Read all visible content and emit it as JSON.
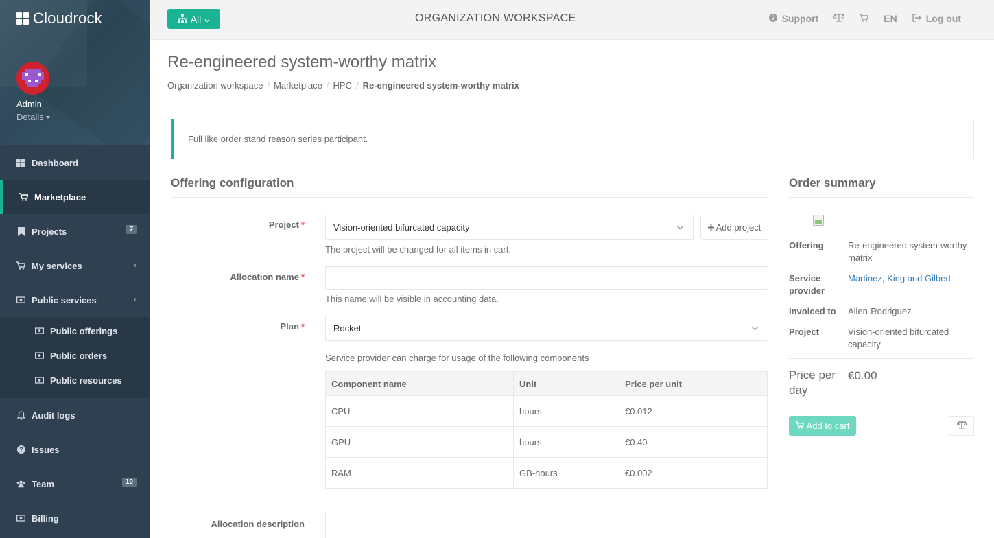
{
  "brand": {
    "name": "Cloudrock"
  },
  "user": {
    "name": "Admin",
    "details_label": "Details"
  },
  "nav": {
    "dashboard": "Dashboard",
    "marketplace": "Marketplace",
    "projects": "Projects",
    "projects_badge": "7",
    "my_services": "My services",
    "public_services": "Public services",
    "public_offerings": "Public offerings",
    "public_orders": "Public orders",
    "public_resources": "Public resources",
    "audit_logs": "Audit logs",
    "issues": "Issues",
    "team": "Team",
    "team_badge": "10",
    "billing": "Billing"
  },
  "topbar": {
    "filter_label": "All",
    "workspace_title": "ORGANIZATION WORKSPACE",
    "support": "Support",
    "language": "EN",
    "logout": "Log out"
  },
  "page": {
    "title": "Re-engineered system-worthy matrix",
    "breadcrumbs": [
      "Organization workspace",
      "Marketplace",
      "HPC"
    ],
    "breadcrumb_current": "Re-engineered system-worthy matrix",
    "alert": "Full like order stand reason series participant."
  },
  "config": {
    "section_title": "Offering configuration",
    "project_label": "Project",
    "project_value": "Vision-oriented bifurcated capacity",
    "add_project": "Add project",
    "project_help": "The project will be changed for all items in cart.",
    "allocation_label": "Allocation name",
    "allocation_value": "",
    "allocation_help": "This name will be visible in accounting data.",
    "plan_label": "Plan",
    "plan_value": "Rocket",
    "components_intro": "Service provider can charge for usage of the following components",
    "table_headers": [
      "Component name",
      "Unit",
      "Price per unit"
    ],
    "components": [
      {
        "name": "CPU",
        "unit": "hours",
        "price": "€0.012"
      },
      {
        "name": "GPU",
        "unit": "hours",
        "price": "€0.40"
      },
      {
        "name": "RAM",
        "unit": "GB-hours",
        "price": "€0.002"
      }
    ],
    "description_label": "Allocation description"
  },
  "summary": {
    "section_title": "Order summary",
    "offering_label": "Offering",
    "offering_value": "Re-engineered system-worthy matrix",
    "provider_label": "Service provider",
    "provider_value": "Martinez, King and Gilbert",
    "invoiced_label": "Invoiced to",
    "invoiced_value": "Allen-Rodriguez",
    "project_label": "Project",
    "project_value": "Vision-oriented bifurcated capacity",
    "price_label": "Price per day",
    "price_value": "€0.00",
    "add_to_cart": "Add to cart"
  },
  "colors": {
    "accent": "#1ab394",
    "sidebar": "#2f4050",
    "required": "#ed5565",
    "link": "#337ab7"
  }
}
